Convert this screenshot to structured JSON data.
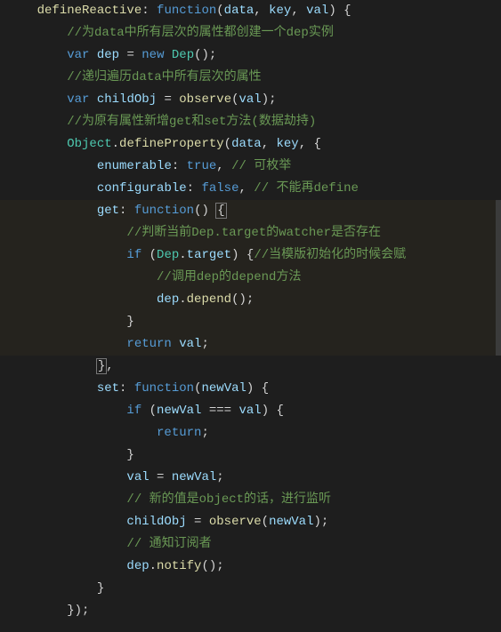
{
  "code": {
    "l1_name": "defineReactive",
    "l1_a": ": ",
    "l1_fn": "function",
    "l1_b": "(",
    "l1_p1": "data",
    "l1_c": ", ",
    "l1_p2": "key",
    "l1_d": ", ",
    "l1_p3": "val",
    "l1_e": ") {",
    "l2_cmt": "//为data中所有层次的属性都创建一个dep实例",
    "l3_a": "var",
    "l3_b": " ",
    "l3_v": "dep",
    "l3_c": " = ",
    "l3_new": "new",
    "l3_d": " ",
    "l3_cls": "Dep",
    "l3_e": "();",
    "l4_cmt": "//递归遍历data中所有层次的属性",
    "l5_a": "var",
    "l5_b": " ",
    "l5_v": "childObj",
    "l5_c": " = ",
    "l5_fn": "observe",
    "l5_d": "(",
    "l5_arg": "val",
    "l5_e": ");",
    "l6_cmt": "//为原有属性新增get和set方法(数据劫持)",
    "l7_obj": "Object",
    "l7_a": ".",
    "l7_fn": "defineProperty",
    "l7_b": "(",
    "l7_p1": "data",
    "l7_c": ", ",
    "l7_p2": "key",
    "l7_d": ", {",
    "l8_k": "enumerable",
    "l8_a": ": ",
    "l8_v": "true",
    "l8_b": ", ",
    "l8_cmt": "// 可枚举",
    "l9_k": "configurable",
    "l9_a": ": ",
    "l9_v": "false",
    "l9_b": ", ",
    "l9_cmt": "// 不能再define",
    "l10_k": "get",
    "l10_a": ": ",
    "l10_fn": "function",
    "l10_b": "() ",
    "l10_brace": "{",
    "l11_cmt": "//判断当前Dep.target的watcher是否存在",
    "l12_if": "if",
    "l12_a": " (",
    "l12_obj": "Dep",
    "l12_b": ".",
    "l12_prop": "target",
    "l12_c": ") {",
    "l12_cmt": "//当模版初始化的时候会赋",
    "l13_cmt": "//调用dep的depend方法",
    "l14_obj": "dep",
    "l14_a": ".",
    "l14_fn": "depend",
    "l14_b": "();",
    "l15": "}",
    "l16_ret": "return",
    "l16_a": " ",
    "l16_v": "val",
    "l16_b": ";",
    "l17_brace": "}",
    "l17_a": ",",
    "l18_k": "set",
    "l18_a": ": ",
    "l18_fn": "function",
    "l18_b": "(",
    "l18_p": "newVal",
    "l18_c": ") {",
    "l19_if": "if",
    "l19_a": " (",
    "l19_v1": "newVal",
    "l19_b": " === ",
    "l19_v2": "val",
    "l19_c": ") {",
    "l20_ret": "return",
    "l20_a": ";",
    "l21": "}",
    "l22_v1": "val",
    "l22_a": " = ",
    "l22_v2": "newVal",
    "l22_b": ";",
    "l23_cmt": "// 新的值是object的话，进行监听",
    "l24_v": "childObj",
    "l24_a": " = ",
    "l24_fn": "observe",
    "l24_b": "(",
    "l24_arg": "newVal",
    "l24_c": ");",
    "l25_cmt": "// 通知订阅者",
    "l26_obj": "dep",
    "l26_a": ".",
    "l26_fn": "notify",
    "l26_b": "();",
    "l27": "}",
    "l28": "});"
  }
}
